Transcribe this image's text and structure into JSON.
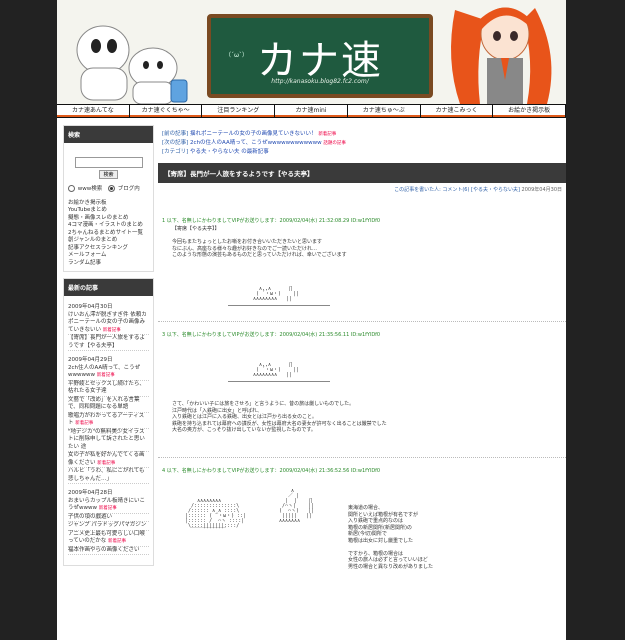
{
  "site": {
    "title": "カナ速",
    "url": "http://kanasoku.blog82.fc2.com/",
    "smiley": "（´ω`）"
  },
  "nav": [
    "カナ速あんてな",
    "カナ速ぐくちゃ～",
    "注目ランキング",
    "カナ速mini",
    "カナ速ちゅ～ぶ",
    "カナ速こみっく",
    "お絵かき掲示板"
  ],
  "sidebar": {
    "search": {
      "title": "検索",
      "button": "検索",
      "option_www": "www検索",
      "option_blog": "ブログ内"
    },
    "links": [
      "お絵かき掲示板",
      "YouTubeまとめ",
      "擬態・画像スレのまとめ",
      "4コマ漫画・イラストのまとめ",
      "2ちゃんねるまとめサイト一覧",
      "創ジャンルのまとめ",
      "記事アクセスランキング",
      "メールフォーム",
      "ランダム記事"
    ],
    "recent": {
      "title": "最新の記事",
      "groups": [
        {
          "date": "2009年04月30日",
          "items": [
            {
              "text": "けいおん澪が脱ぎすぎ件 依頼カポニーテールの女の子の画像みていきないい",
              "new": "新着記事"
            },
            {
              "text": "【寄席】長門が一人旅をするようです【やる夫亭】",
              "new": ""
            }
          ]
        },
        {
          "date": "2009年04月29日",
          "items": [
            {
              "text": "2ch住人のAA晴って、こうぜwwwwww",
              "new": "新着記事"
            },
            {
              "text": "平野綾とセックスし続けたら、枯れたる女子達",
              "new": ""
            },
            {
              "text": "文藝で「改め」を入れる言葉で、同和問題になる単語",
              "new": ""
            },
            {
              "text": "歌唱力がわかってるアーティスト",
              "new": "新着記事"
            },
            {
              "text": "\"地デジカ\"の無料美少女イラストに削除申して訴されたと思いたい 途",
              "new": ""
            },
            {
              "text": "女の子が私を好かんでてくる画像ください",
              "new": "新着記事"
            },
            {
              "text": "ハルヒ「うわ、私にこがれても悲しちゃんだ…」",
              "new": ""
            }
          ]
        },
        {
          "date": "2009年04月28日",
          "items": [
            {
              "text": "おまいらカップル板晴きにいこうぜwwww",
              "new": "新着記事"
            },
            {
              "text": "子供の頃の戯遊い",
              "new": ""
            },
            {
              "text": "ジャンプ パラドッグパマガジン",
              "new": ""
            },
            {
              "text": "アニメ史上最も可愛らしい口喉っていのだかな",
              "new": "新着記事"
            },
            {
              "text": "福本作画やらの画像ください",
              "new": ""
            }
          ]
        }
      ]
    }
  },
  "main": {
    "related": [
      {
        "cat": "[前の記事]",
        "text": "揺れポニーテールの女の子の画像見ていきないい！",
        "new": "新着記事",
        "hot": ""
      },
      {
        "cat": "[次の記事]",
        "text": "2chの住人のAA晴って、こうぜwwwwwwwwwwww",
        "new": "",
        "hot": "話題の記事"
      },
      {
        "cat": "[カテゴリ]",
        "text": "やる夫・やらない夫 の最新記事",
        "new": "",
        "hot": ""
      }
    ],
    "entry_title": "【寄席】長門が一人旅をするようです【やる夫亭】",
    "entry_meta": {
      "lead": "コメント(6)",
      "links": [
        "この記事を書いた人:",
        "コメント(6)",
        "[やる夫・やらない夫]"
      ],
      "date": "2009年04月30日"
    },
    "posts": [
      {
        "header": "1 以下、名無しにかわりましてVIPがお送りします：2009/02/04(水) 21:32:08.29 ID:w1fYlDf0",
        "lines": [
          "【寄席【やる夫亭】】",
          "",
          "今回もまたちょっとしたお噺をお付き合いいただきたいと思います",
          "なにぶん、高座なる様々な趣がお好きなのでご一読いただけれ…",
          "このような形態の演芸もあるものだと思っていただければ、幸いでございます"
        ]
      },
      {
        "header": "3 以下、名無しにかわりましてVIPがお送りします：2009/02/04(水) 21:35:56.11 ID:w1fYlDf0",
        "lines": [
          "さて、「かわいい子には旅をさせろ」と言うように、昔の旅は厳しいものでした。",
          "江戸時代は「入鉄砲に出女」と呼ばれ、",
          "入り鉄砲とは江戸に入る鉄砲、出女とは江戸から出る女のこと。",
          "鉄砲を持ち込まれては幕府への謀反が、女性は幕府大名の妻女が許可なく出ることは厳禁でした",
          "大名の奥方が、こっそり抜け出していないか監視したものです。"
        ]
      },
      {
        "header": "4 以下、名無しにかわりましてVIPがお送りします：2009/02/04(水) 21:36:52.56 ID:w1fYlDf0",
        "lines": [
          "東海道の場合、",
          "関所といえば箱根が有名ですが",
          "入り鉄砲で重点的なのは",
          "箱根の新居関所(新居関所)の",
          "新居(今切)関所で",
          "箱根は出女に対し厳重でした",
          "",
          "ですから、箱根の場合は",
          "女性の旅人は必ずと言っていいほど",
          "男性の場合と異なり改めがありました"
        ]
      }
    ]
  }
}
